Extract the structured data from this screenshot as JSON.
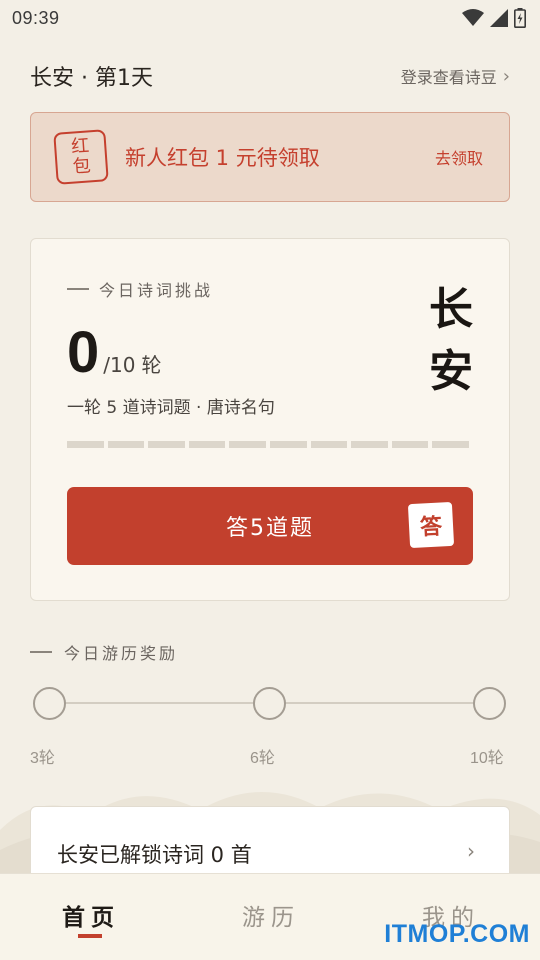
{
  "status_bar": {
    "time": "09:39"
  },
  "header": {
    "city_day": "长安 · 第1天",
    "login_link": "登录查看诗豆"
  },
  "redpack": {
    "stamp_top": "红",
    "stamp_bottom": "包",
    "text": "新人红包 1 元待领取",
    "claim": "去领取"
  },
  "challenge": {
    "label": "今日诗词挑战",
    "score": "0",
    "total": "/10",
    "unit": "轮",
    "desc": "一轮 5 道诗词题 · 唐诗名句",
    "city_top": "长",
    "city_bottom": "安",
    "progress_done": 0,
    "progress_total": 10,
    "answer_button": "答5道题",
    "answer_stamp": "答"
  },
  "reward": {
    "label": "今日游历奖励",
    "milestones": [
      "3轮",
      "6轮",
      "10轮"
    ]
  },
  "unlock": {
    "text": "长安已解锁诗词 0 首"
  },
  "nav": {
    "home": "首页",
    "travel": "游历",
    "mine": "我的"
  },
  "watermark": "ITMOP.COM",
  "colors": {
    "accent": "#c2402d",
    "background": "#f3efe6"
  }
}
